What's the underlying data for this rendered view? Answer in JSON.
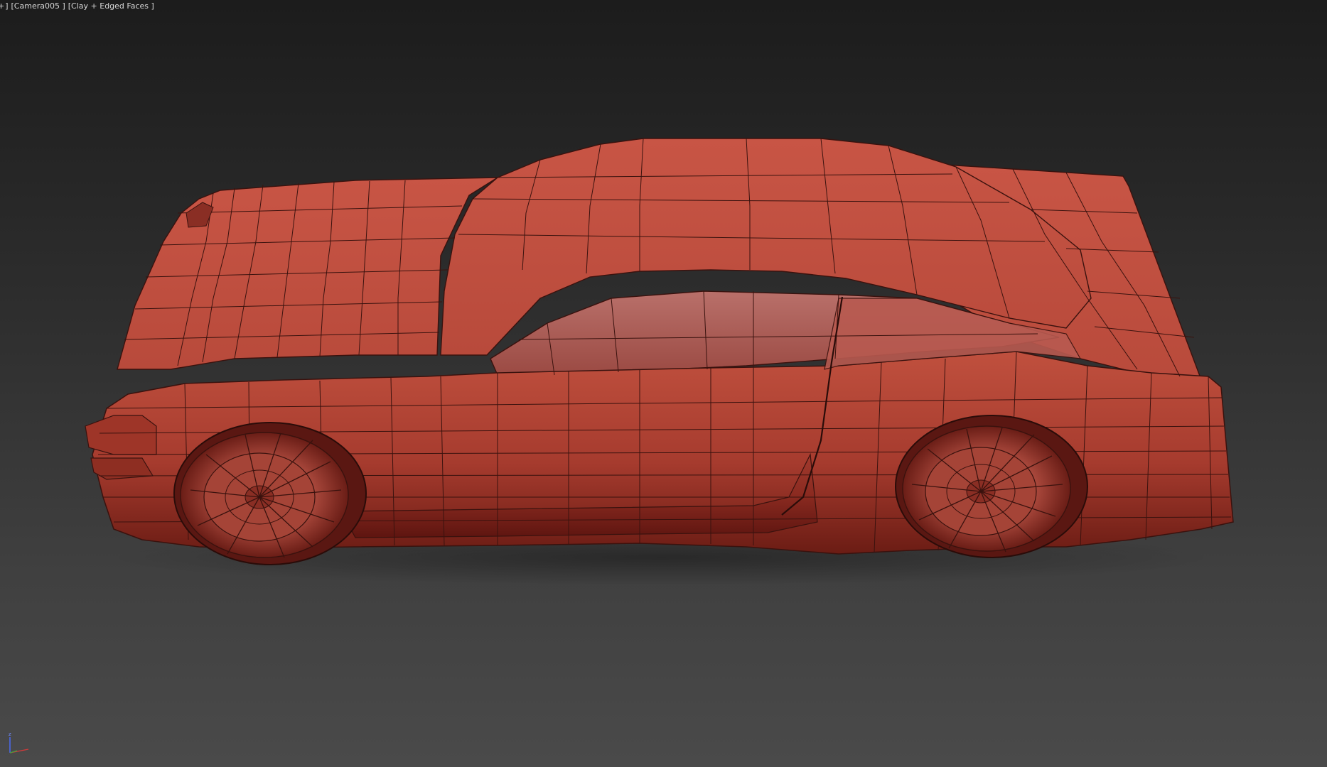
{
  "viewport": {
    "label_prefix": "+",
    "label_bracket_close": "]",
    "camera_label": "[Camera005 ]",
    "shading_label": "[Clay + Edged Faces ]"
  },
  "model": {
    "name": "car-model",
    "material_color": "#b8483a",
    "wire_color": "#3a120e"
  },
  "gizmo": {
    "axis_label": "z",
    "colors": {
      "x": "#d23a3a",
      "y": "#3fa33f",
      "z": "#4a6cff"
    }
  }
}
